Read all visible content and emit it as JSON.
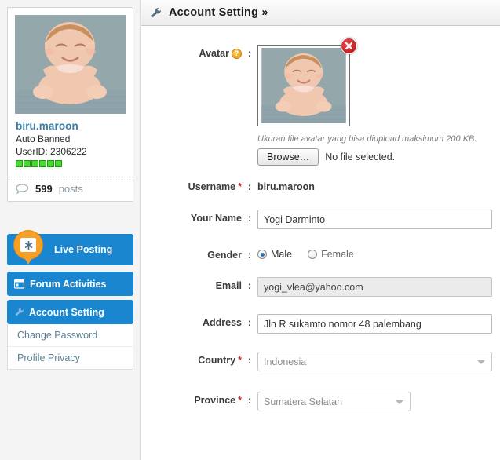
{
  "sidebar": {
    "profile": {
      "avatar_icon": "user-avatar-photo",
      "username": "biru.maroon",
      "status": "Auto Banned",
      "userid": "UserID: 2306222",
      "reputation_blocks": 6,
      "posts_count": "599",
      "posts_word": "posts",
      "posts_icon": "speech-bubble-icon"
    },
    "nav": [
      {
        "label": "Live Posting",
        "icon": "live-posting-pin-icon",
        "active": false
      },
      {
        "label": "Forum Activities",
        "icon": "calendar-icon",
        "active": false
      },
      {
        "label": "Account Setting",
        "icon": "wrench-icon",
        "active": true
      }
    ],
    "submenu": [
      {
        "label": "Change Password"
      },
      {
        "label": "Profile Privacy"
      }
    ]
  },
  "main": {
    "header": {
      "icon": "wrench-icon",
      "title": "Account Setting »"
    },
    "form": {
      "avatar": {
        "label": "Avatar",
        "help_icon": "question-help-icon",
        "colon": ":",
        "image_icon": "user-avatar-photo",
        "delete_icon": "close-x-icon",
        "hint": "Ukuran file avatar yang bisa diupload maksimum 200 KB.",
        "browse_label": "Browse…",
        "no_file_text": "No file selected."
      },
      "username": {
        "label": "Username",
        "required": "*",
        "colon": ":",
        "value": "biru.maroon"
      },
      "your_name": {
        "label": "Your Name",
        "colon": ":",
        "value": "Yogi Darminto",
        "placeholder": ""
      },
      "gender": {
        "label": "Gender",
        "colon": ":",
        "selected": "Male",
        "options": [
          "Male",
          "Female"
        ]
      },
      "email": {
        "label": "Email",
        "colon": ":",
        "value": "yogi_vlea@yahoo.com",
        "disabled": true
      },
      "address": {
        "label": "Address",
        "colon": ":",
        "value": "Jln R sukamto nomor 48 palembang",
        "placeholder": ""
      },
      "country": {
        "label": "Country",
        "required": "*",
        "colon": ":",
        "value": "Indonesia",
        "caret_icon": "chevron-down-icon"
      },
      "province": {
        "label": "Province",
        "required": "*",
        "colon": ":",
        "value": "Sumatera Selatan",
        "caret_icon": "chevron-down-icon"
      }
    }
  },
  "colors": {
    "nav_blue": "#1b86d0",
    "link_blue": "#3b7fa6",
    "accent_orange": "#f6a028",
    "required_red": "#cc2b2b",
    "delete_red": "#b01217",
    "rep_green": "#4ad636"
  }
}
